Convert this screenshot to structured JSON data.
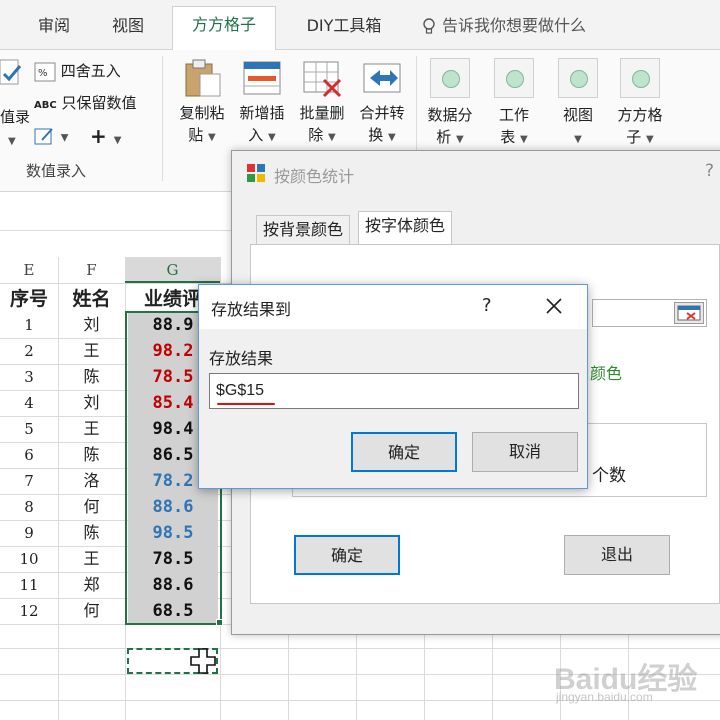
{
  "ribbon_tabs": [
    "审阅",
    "视图",
    "方方格子",
    "DIY工具箱"
  ],
  "active_tab": "方方格子",
  "tell_me": "告诉我你想要做什么",
  "ribbon": {
    "partial_left_1": "值录",
    "round_label": "四舍五入",
    "keep_value_label": "只保留数值",
    "plus_label": "+",
    "group_label": "数值录入",
    "big_buttons": [
      {
        "l1": "复制粘",
        "l2": "贴"
      },
      {
        "l1": "新增插",
        "l2": "入"
      },
      {
        "l1": "批量删",
        "l2": "除"
      },
      {
        "l1": "合并转",
        "l2": "换"
      }
    ],
    "circle_buttons": [
      {
        "l1": "数据分",
        "l2": "析"
      },
      {
        "l1": "工作",
        "l2": "表"
      },
      {
        "l1": "视图",
        "l2": ""
      },
      {
        "l1": "方方格",
        "l2": "子"
      }
    ]
  },
  "sheet": {
    "columns": [
      "E",
      "F",
      "G"
    ],
    "headers": [
      "序号",
      "姓名",
      "业绩评"
    ],
    "rows": [
      {
        "no": "1",
        "name": "刘",
        "score": "88.9",
        "color": "#111111"
      },
      {
        "no": "2",
        "name": "王",
        "score": "98.2",
        "color": "#c00000"
      },
      {
        "no": "3",
        "name": "陈",
        "score": "78.5",
        "color": "#c00000"
      },
      {
        "no": "4",
        "name": "刘",
        "score": "85.4",
        "color": "#c00000"
      },
      {
        "no": "5",
        "name": "王",
        "score": "98.4",
        "color": "#111111"
      },
      {
        "no": "6",
        "name": "陈",
        "score": "86.5",
        "color": "#111111"
      },
      {
        "no": "7",
        "name": "洛",
        "score": "78.2",
        "color": "#2e75b6"
      },
      {
        "no": "8",
        "name": "何",
        "score": "88.6",
        "color": "#2e75b6"
      },
      {
        "no": "9",
        "name": "陈",
        "score": "98.5",
        "color": "#2e75b6"
      },
      {
        "no": "10",
        "name": "王",
        "score": "78.5",
        "color": "#111111"
      },
      {
        "no": "11",
        "name": "郑",
        "score": "88.6",
        "color": "#111111"
      },
      {
        "no": "12",
        "name": "何",
        "score": "68.5",
        "color": "#111111"
      }
    ]
  },
  "dialog_back": {
    "title": "按颜色统计",
    "help": "?",
    "tabs": [
      "按背景颜色",
      "按字体颜色"
    ],
    "active_tab": "按字体颜色",
    "partial_green": "颜色",
    "partial_count": "个数",
    "ok_label": "确定",
    "exit_label": "退出"
  },
  "dialog_front": {
    "title": "存放结果到",
    "help": "?",
    "field_label": "存放结果",
    "field_value": "$G$15",
    "ok_label": "确定",
    "cancel_label": "取消"
  },
  "watermark": {
    "brand": "Baidu经验",
    "url": "jingyan.baidu.com"
  }
}
